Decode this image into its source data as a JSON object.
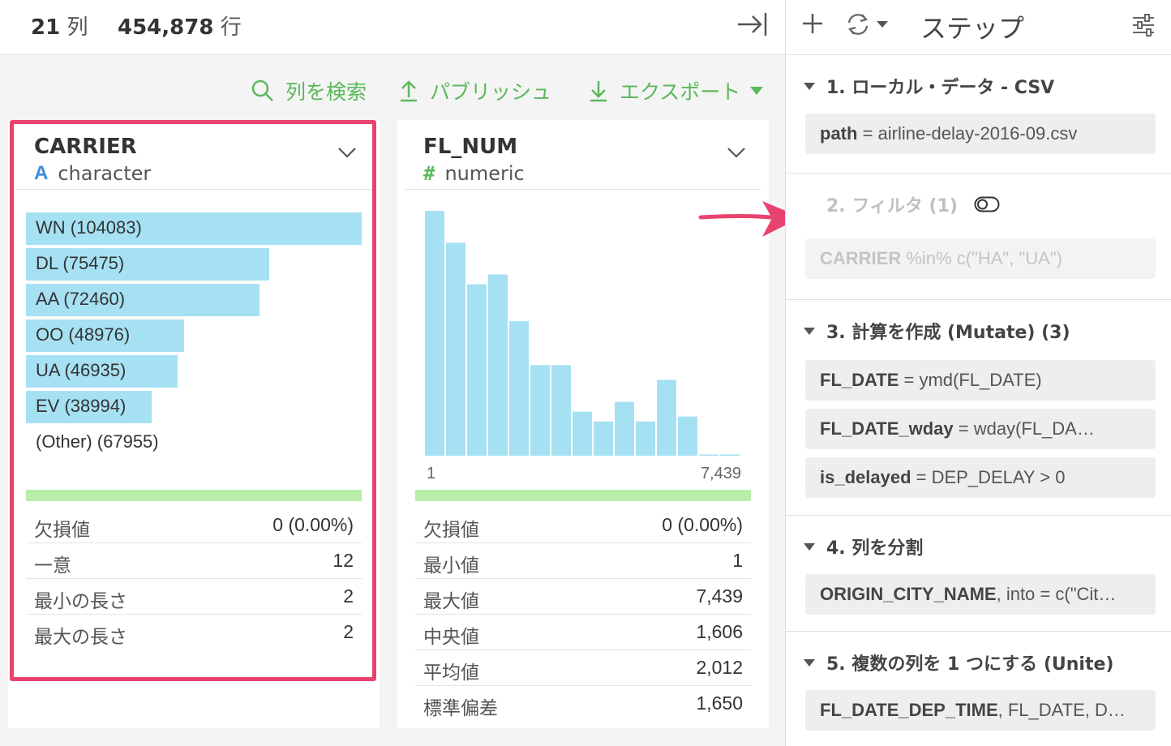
{
  "topbar": {
    "columns_count": "21",
    "columns_unit": "列",
    "rows_count": "454,878",
    "rows_unit": "行"
  },
  "actions": {
    "search": "列を検索",
    "publish": "パブリッシュ",
    "export": "エクスポート"
  },
  "accent_colors": {
    "green": "#5cb85c",
    "bar": "#a6e1f3",
    "highlight": "#e8436f",
    "type_char": "#3c8ddc"
  },
  "carrier": {
    "name": "CARRIER",
    "type_icon": "A",
    "type": "character",
    "bars": [
      {
        "label": "WN (104083)",
        "value": 104083
      },
      {
        "label": "DL (75475)",
        "value": 75475
      },
      {
        "label": "AA (72460)",
        "value": 72460
      },
      {
        "label": "OO (48976)",
        "value": 48976
      },
      {
        "label": "UA (46935)",
        "value": 46935
      },
      {
        "label": "EV (38994)",
        "value": 38994
      },
      {
        "label": "(Other) (67955)",
        "value": 0
      }
    ],
    "stats": [
      {
        "label": "欠損値",
        "value": "0 (0.00%)"
      },
      {
        "label": "一意",
        "value": "12"
      },
      {
        "label": "最小の長さ",
        "value": "2"
      },
      {
        "label": "最大の長さ",
        "value": "2"
      }
    ]
  },
  "flnum": {
    "name": "FL_NUM",
    "type_icon": "#",
    "type": "numeric",
    "axis_min": "1",
    "axis_max": "7,439",
    "stats": [
      {
        "label": "欠損値",
        "value": "0 (0.00%)"
      },
      {
        "label": "最小値",
        "value": "1"
      },
      {
        "label": "最大値",
        "value": "7,439"
      },
      {
        "label": "中央値",
        "value": "1,606"
      },
      {
        "label": "平均値",
        "value": "2,012"
      },
      {
        "label": "標準偏差",
        "value": "1,650"
      }
    ]
  },
  "chart_data": {
    "type": "bar",
    "title": "",
    "xlabel": "",
    "ylabel": "",
    "x_range": [
      1,
      7439
    ],
    "values": [
      100,
      87,
      70,
      74,
      55,
      37,
      37,
      18,
      14,
      22,
      14,
      31,
      16,
      0.5,
      0.5,
      4
    ]
  },
  "steps_panel": {
    "title": "ステップ",
    "steps": [
      {
        "title": "1. ローカル・データ - CSV",
        "items": [
          {
            "key": "path",
            "rest": " = airline-delay-2016-09.csv"
          }
        ]
      },
      {
        "title": "2. フィルタ (1)",
        "items": [
          {
            "key": "CARRIER",
            "rest": " %in% c(\"HA\", \"UA\")"
          }
        ]
      },
      {
        "title": "3. 計算を作成 (Mutate) (3)",
        "items": [
          {
            "key": "FL_DATE",
            "rest": " = ymd(FL_DATE)"
          },
          {
            "key": "FL_DATE_wday",
            "rest": " = wday(FL_DA…"
          },
          {
            "key": "is_delayed",
            "rest": " = DEP_DELAY > 0"
          }
        ]
      },
      {
        "title": "4. 列を分割",
        "items": [
          {
            "key": "ORIGIN_CITY_NAME",
            "rest": ", into = c(\"Cit…"
          }
        ]
      },
      {
        "title": "5. 複数の列を 1 つにする (Unite)",
        "items": [
          {
            "key": "FL_DATE_DEP_TIME",
            "rest": ", FL_DATE, D…"
          }
        ]
      }
    ]
  }
}
